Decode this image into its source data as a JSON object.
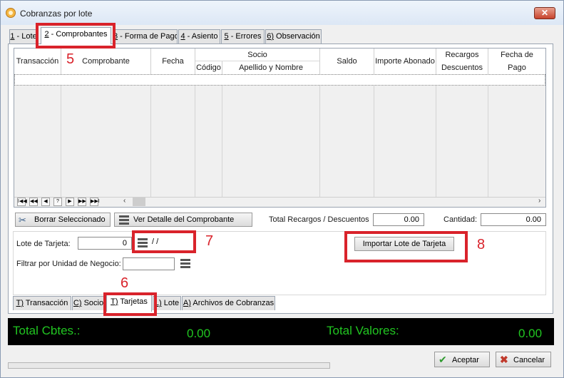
{
  "window": {
    "title": "Cobranzas por lote",
    "close_glyph": "✕"
  },
  "top_tabs": [
    {
      "key": "1",
      "label": " - Lote"
    },
    {
      "key": "2",
      "label": " - Comprobantes"
    },
    {
      "key": "3",
      "label": " - Forma de Pago"
    },
    {
      "key": "4",
      "label": " - Asiento"
    },
    {
      "key": "5",
      "label": " - Errores"
    },
    {
      "key": "6)",
      "label": " Observación"
    }
  ],
  "grid": {
    "headers": {
      "transaccion": "Transacción",
      "comprobante": "Comprobante",
      "fecha": "Fecha",
      "socio": "Socio",
      "codigo": "Código",
      "apellido": "Apellido y Nombre",
      "saldo": "Saldo",
      "importe": "Importe Abonado",
      "recargos": "Recargos",
      "descuentos": "Descuentos",
      "fecha_de": "Fecha de",
      "pago": "Pago"
    },
    "nav": [
      "I◀◀",
      "◀◀",
      "◀",
      "?",
      "▶",
      "▶▶",
      "▶▶I"
    ]
  },
  "actions": {
    "borrar": "Borrar Seleccionado",
    "ver_detalle": "Ver Detalle del Comprobante",
    "total_recargos_label": "Total Recargos / Descuentos",
    "total_recargos_value": "0.00",
    "cantidad_label": "Cantidad:",
    "cantidad_value": "0.00"
  },
  "filters": {
    "lote_label": "Lote de Tarjeta:",
    "lote_value": "0",
    "fecha_value": " / /",
    "unidad_label": "Filtrar por Unidad de Negocio:",
    "importar": "Importar Lote  de Tarjeta"
  },
  "bottom_tabs": [
    {
      "key": "T)",
      "label": " Transacción"
    },
    {
      "key": "C)",
      "label": " Socio"
    },
    {
      "key": "T)",
      "label": " Tarjetas"
    },
    {
      "key": "L)",
      "label": " Lote"
    },
    {
      "key": "A)",
      "label": " Archivos de Cobranzas"
    }
  ],
  "totals": {
    "cbtes_label": "Total Cbtes.:",
    "cbtes_value": "0.00",
    "valores_label": "Total Valores:",
    "valores_value": "0.00"
  },
  "footer": {
    "aceptar": "Aceptar",
    "cancelar": "Cancelar"
  },
  "annotations": {
    "a5": "5",
    "a6": "6",
    "a7": "7",
    "a8": "8"
  },
  "colors": {
    "annotation": "#d9232b",
    "totals": "#21c521",
    "totals_bg": "#000000"
  }
}
